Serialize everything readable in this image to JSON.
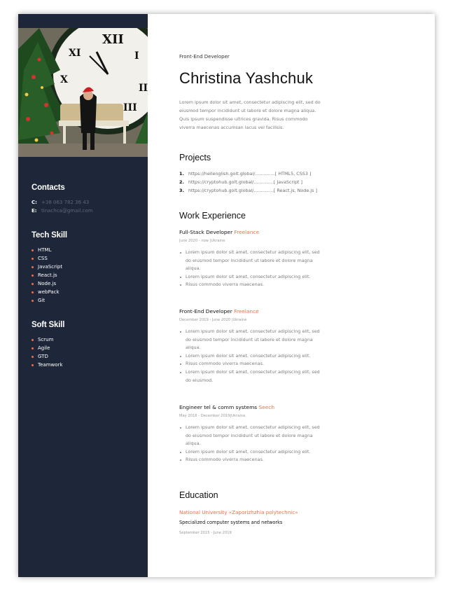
{
  "contacts": {
    "title": "Contacts",
    "items": [
      {
        "label": "C:",
        "value": "+38 063 782 36 43"
      },
      {
        "label": "E:",
        "value": "tinachca@gmail.com"
      }
    ]
  },
  "tech": {
    "title": "Tech Skill",
    "items": [
      "HTML",
      "CSS",
      "JavaScript",
      "React.js",
      "Node.js",
      "webPack",
      "Git"
    ]
  },
  "soft": {
    "title": "Soft Skill",
    "items": [
      "Scrum",
      "Agile",
      "GTD",
      "Teamwork"
    ]
  },
  "header": {
    "role": "Front-End Developer",
    "name": "Christina Yashchuk",
    "summary": "Lorem ipsum dolor sit amet, consectetur adipiscing elit, sed do eiusmod tempor incididunt ut labore et dolore magna aliqua. Quis ipsum suspendisse ultrices gravida. Risus commodo viverra maecenas accumsan lacus vel facilisis."
  },
  "projects": {
    "title": "Projects",
    "items": [
      {
        "num": "1.",
        "text": "https://hellenglish.goit.global/..............[ HTML5, CSS3 ]"
      },
      {
        "num": "2.",
        "text": "https://cryptohub.goit.global/..............[ JavaScript ]"
      },
      {
        "num": "3.",
        "text": "https://cryptohub.goit.global/..............[ React.js, Node.js ]"
      }
    ]
  },
  "work": {
    "title": "Work Experience",
    "jobs": [
      {
        "position": "Full-Stack Developer",
        "company": "Freelance",
        "dates": "June 2020 - now |Ukraine",
        "duties": [
          "Lorem ipsum dolor sit amet, consectetur adipiscing elit, sed do eiusmod tempor incididunt ut labore et dolore magna aliqua.",
          "Lorem ipsum dolor sit amet, consectetur adipiscing elit.",
          "Risus commodo viverra maecenas."
        ]
      },
      {
        "position": "Front-End Developer",
        "company": "Freelance",
        "dates": "December 2019 - June 2020 |Ukraine",
        "duties": [
          "Lorem ipsum dolor sit amet, consectetur adipiscing elit, sed do eiusmod tempor incididunt ut labore et dolore magna aliqua.",
          "Lorem ipsum dolor sit amet, consectetur adipiscing elit.",
          "Risus commodo viverra maecenas.",
          "Lorem ipsum dolor sit amet, consectetur adipiscing elit, sed do eiusmod."
        ]
      },
      {
        "position": "Engineer tel & comm systems",
        "company": "Seech",
        "dates": "May 2016 - December 2019|Ukraine",
        "duties": [
          "Lorem ipsum dolor sit amet, consectetur adipiscing elit, sed do eiusmod tempor incididunt ut labore et dolore magna aliqua.",
          "Lorem ipsum dolor sit amet, consectetur adipiscing elit.",
          "Risus commodo viverra maecenas."
        ]
      }
    ]
  },
  "education": {
    "title": "Education",
    "university": "National University «Zaporizhzhia polytechnic»",
    "specialty": "Specialized computer systems and networks",
    "dates": "September 2015 - June 2019"
  },
  "colors": {
    "sidebar": "#1e2739",
    "accent": "#e8744d"
  }
}
